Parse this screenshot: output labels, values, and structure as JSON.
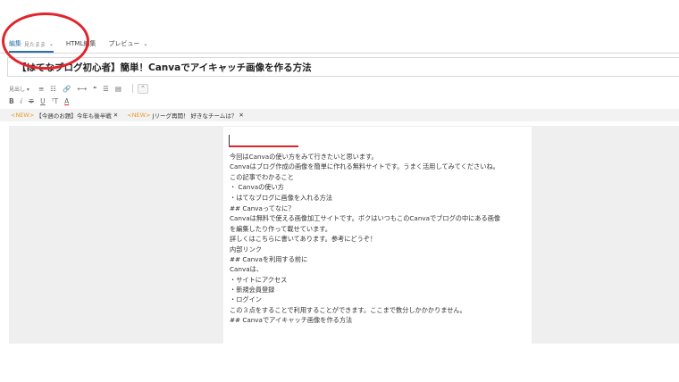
{
  "tabs": [
    {
      "label": "編集",
      "sub": "見たまま",
      "active": true
    },
    {
      "label": "HTML編集"
    },
    {
      "label": "プレビュー"
    }
  ],
  "title": "【はてなブログ初心者】簡単！Canvaでアイキャッチ画像を作る方法",
  "toolbar": {
    "heading_select": "見出し",
    "row1": [
      "≡",
      "☷",
      "🔗",
      "⟷",
      "❝",
      "☰",
      "▤"
    ],
    "row2_bold": "B",
    "row2_italic": "i",
    "row2_strike": "∓",
    "row2_underline": "U",
    "row2_fontsize": "ᵀT",
    "row2_color": "A"
  },
  "notices": [
    {
      "tag": "<NEW>",
      "text": "【今週のお題】今年も後半戦"
    },
    {
      "tag": "<NEW>",
      "text": "Jリーグ再開！ 好きなチームは？"
    }
  ],
  "body_lines": [
    "今回はCanvaの使い方をみて行きたいと思います。",
    "Canvaはブログ作成の画像を簡単に作れる無料サイトです。うまく活用してみてくださいね。",
    "この記事でわかること",
    "・ Canvaの使い方",
    "・はてなブログに画像を入れる方法",
    "",
    "## Canvaってなに？",
    "Canvaは無料で使える画像加工サイトです。ボクはいつもこのCanvaでブログの中にある画像",
    "を編集したり作って載せています。",
    "詳しくはこちらに書いてあります。参考にどうぞ！",
    "内部リンク",
    "## Canvaを利用する前に",
    "Canvaは、",
    "・サイトにアクセス",
    "・新規会員登録",
    "・ログイン",
    "この３点をすることで利用することができます。ここまで数分しかかかりません。",
    "## Canvaでアイキャッチ画像を作る方法"
  ]
}
